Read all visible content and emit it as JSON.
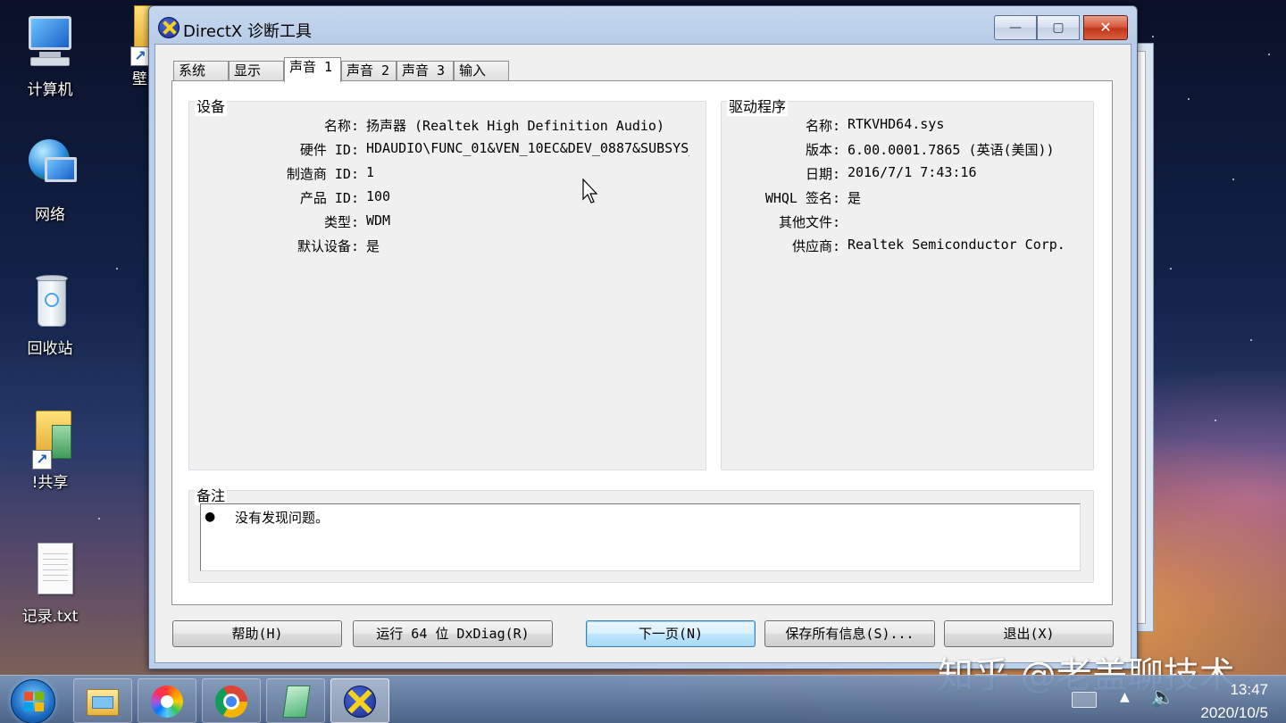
{
  "desktop": {
    "icons": [
      {
        "label": "计算机"
      },
      {
        "label": "壁"
      },
      {
        "label": "网络"
      },
      {
        "label": "回收站"
      },
      {
        "label": "!共享"
      },
      {
        "label": "记录.txt"
      }
    ]
  },
  "window": {
    "title": "DirectX 诊断工具",
    "minimize": "—",
    "maximize": "▢",
    "close": "✕"
  },
  "tabs": [
    {
      "label": "系统"
    },
    {
      "label": "显示"
    },
    {
      "label": "声音 1",
      "active": true
    },
    {
      "label": "声音 2"
    },
    {
      "label": "声音 3"
    },
    {
      "label": "输入"
    }
  ],
  "device": {
    "title": "设备",
    "rows": [
      {
        "key": "名称:",
        "value": "扬声器 (Realtek High Definition Audio)"
      },
      {
        "key": "硬件 ID:",
        "value": "HDAUDIO\\FUNC_01&VEN_10EC&DEV_0887&SUBSYS_"
      },
      {
        "key": "制造商 ID:",
        "value": "1"
      },
      {
        "key": "产品 ID:",
        "value": "100"
      },
      {
        "key": "类型:",
        "value": "WDM"
      },
      {
        "key": "默认设备:",
        "value": "是"
      }
    ]
  },
  "driver": {
    "title": "驱动程序",
    "rows": [
      {
        "key": "名称:",
        "value": "RTKVHD64.sys"
      },
      {
        "key": "版本:",
        "value": "6.00.0001.7865 (英语(美国))"
      },
      {
        "key": "日期:",
        "value": "2016/7/1 7:43:16"
      },
      {
        "key": "WHQL 签名:",
        "value": "是"
      },
      {
        "key": "其他文件:",
        "value": ""
      },
      {
        "key": "供应商:",
        "value": "Realtek Semiconductor Corp."
      }
    ]
  },
  "notes": {
    "title": "备注",
    "items": [
      "没有发现问题。"
    ]
  },
  "buttons": {
    "help": "帮助(H)",
    "run64": "运行 64 位 DxDiag(R)",
    "next": "下一页(N)",
    "save": "保存所有信息(S)...",
    "exit": "退出(X)"
  },
  "taskbar": {
    "apps": [
      "file-explorer",
      "media-player",
      "chrome",
      "notepad",
      "directx-diag"
    ],
    "time": "13:47",
    "date": "2020/10/5"
  },
  "watermark": "知乎 @老盖聊技术"
}
